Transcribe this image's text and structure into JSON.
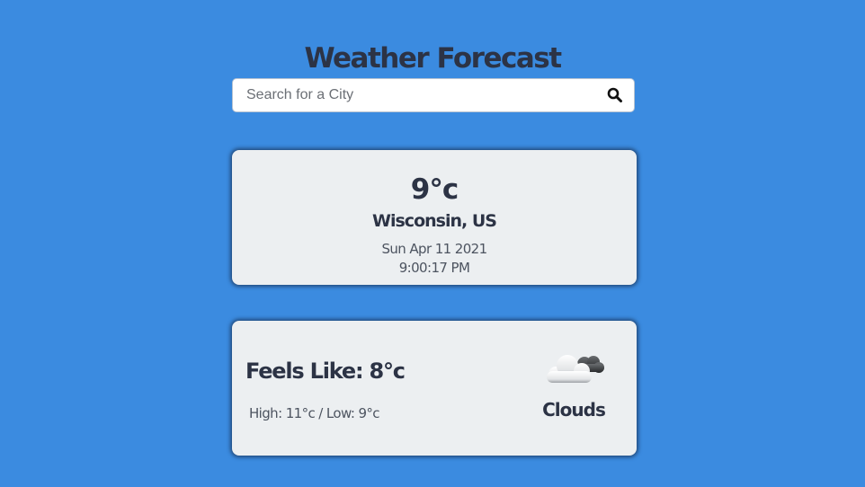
{
  "header": {
    "title": "Weather Forecast"
  },
  "search": {
    "placeholder": "Search for a City",
    "value": "",
    "button_icon": "search-icon"
  },
  "current": {
    "temperature": "9°c",
    "location": "Wisconsin, US",
    "date": "Sun Apr 11 2021",
    "time": "9:00:17 PM"
  },
  "details": {
    "feels_like": "Feels Like: 8°c",
    "high_low": "High: 11°c / Low: 9°c",
    "condition": "Clouds",
    "condition_icon": "clouds-icon"
  },
  "colors": {
    "background": "#3b8be0",
    "card": "#eceff1",
    "text_dark": "#2c3345",
    "text_muted": "#4d5460"
  }
}
